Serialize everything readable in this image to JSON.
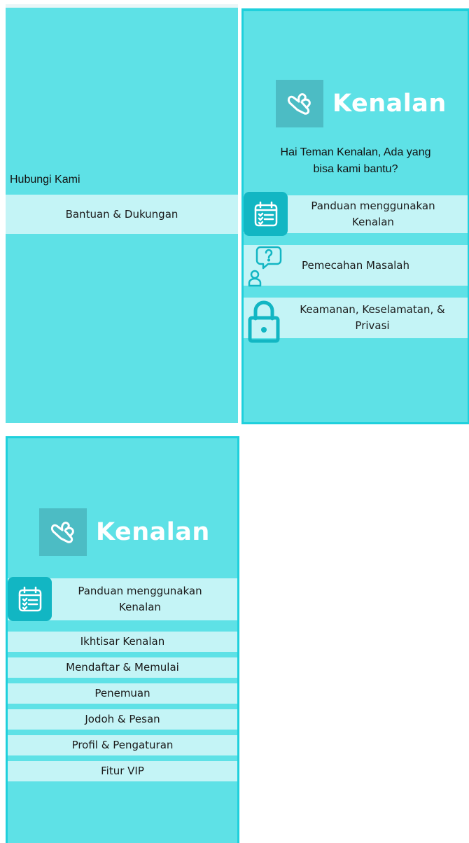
{
  "panel_left": {
    "contact_heading": "Hubungi Kami",
    "support_item": "Bantuan & Dukungan"
  },
  "panel_right": {
    "logo_text": "Kenalan",
    "greeting_line1": "Hai Teman Kenalan, Ada yang",
    "greeting_line2": "bisa kami bantu?",
    "menu": [
      {
        "line1": "Panduan menggunakan",
        "line2": "Kenalan",
        "icon": "calendar-checklist-icon"
      },
      {
        "line1": "Pemecahan Masalah",
        "icon": "person-question-icon"
      },
      {
        "line1": "Keamanan, Keselamatan, &",
        "line2": "Privasi",
        "icon": "padlock-icon"
      }
    ]
  },
  "panel_bottom": {
    "logo_text": "Kenalan",
    "guide_header": {
      "line1": "Panduan menggunakan",
      "line2": "Kenalan",
      "icon": "calendar-checklist-icon"
    },
    "sub_items": [
      "Ikhtisar Kenalan",
      "Mendaftar & Memulai",
      "Penemuan",
      "Jodoh & Pesan",
      "Profil & Pengaturan",
      "Fitur VIP"
    ]
  },
  "colors": {
    "background": "#5ee1e6",
    "band": "#c4f4f6",
    "accent": "#12b6c3",
    "logo_tile": "#4cbcc4"
  }
}
